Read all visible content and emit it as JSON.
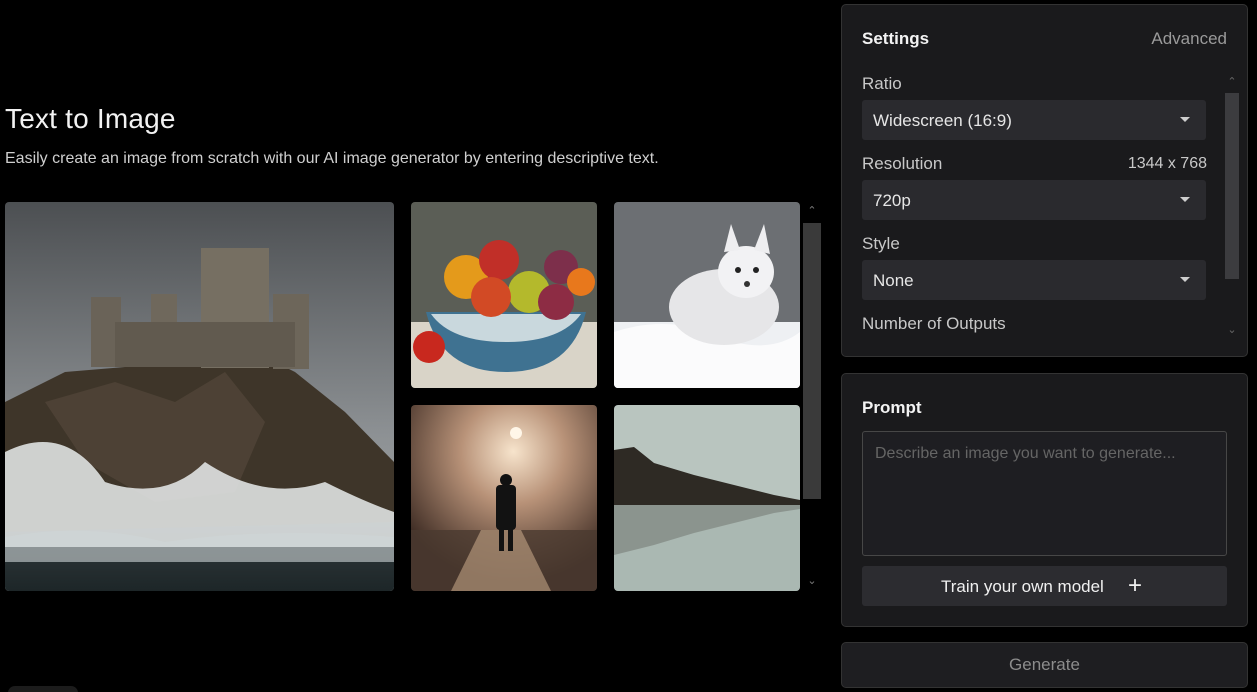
{
  "hero": {
    "title": "Text to Image",
    "subtitle": "Easily create an image from scratch with our AI image generator by entering descriptive text."
  },
  "gallery": {
    "images": [
      {
        "name": "castle-on-cliff"
      },
      {
        "name": "fruit-bowl-painting"
      },
      {
        "name": "white-fox"
      },
      {
        "name": "man-in-fog-street"
      },
      {
        "name": "lake-forest-reflection"
      }
    ]
  },
  "settings": {
    "title": "Settings",
    "advanced_label": "Advanced",
    "ratio": {
      "label": "Ratio",
      "value": "Widescreen (16:9)"
    },
    "resolution": {
      "label": "Resolution",
      "dimensions": "1344 x 768",
      "value": "720p"
    },
    "style": {
      "label": "Style",
      "value": "None"
    },
    "outputs": {
      "label": "Number of Outputs"
    }
  },
  "prompt": {
    "title": "Prompt",
    "placeholder": "Describe an image you want to generate...",
    "value": "",
    "train_label": "Train your own model",
    "train_icon": "plus-icon"
  },
  "generate_label": "Generate",
  "colors": {
    "background": "#000000",
    "panel": "#1a1a1c",
    "control": "#2a2a2e"
  }
}
